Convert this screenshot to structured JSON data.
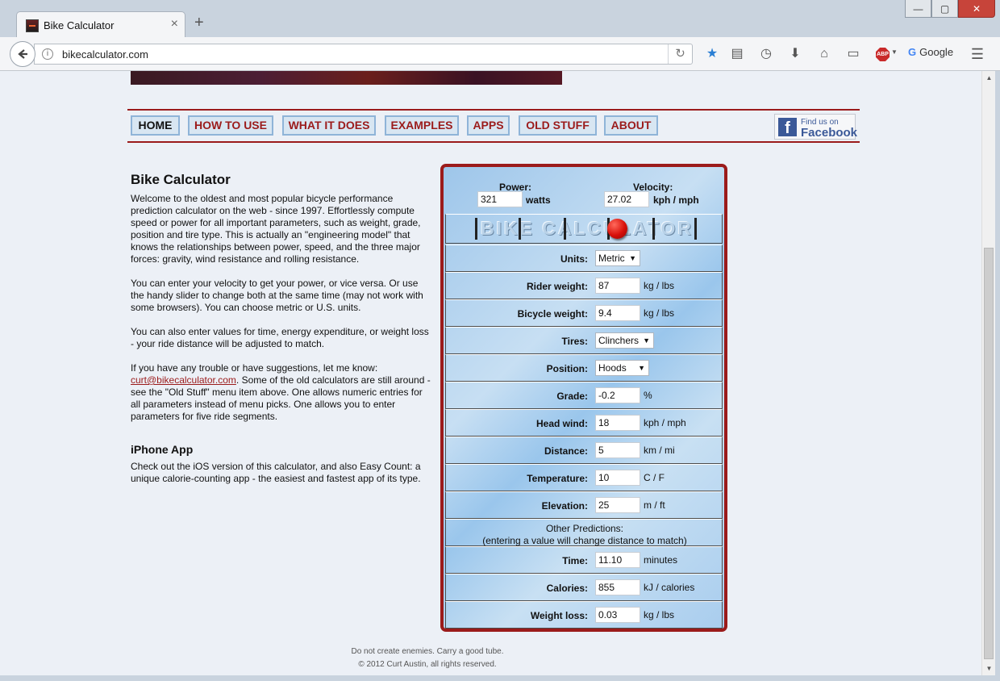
{
  "browser": {
    "tab_title": "Bike Calculator",
    "tab_close": "×",
    "new_tab": "+",
    "url": "bikecalculator.com",
    "search_engine": "Google",
    "window_buttons": {
      "minimize": "—",
      "maximize": "▢",
      "close": "✕"
    }
  },
  "menu": {
    "items": [
      "HOME",
      "HOW TO USE",
      "WHAT IT DOES",
      "EXAMPLES",
      "APPS",
      "OLD STUFF",
      "ABOUT"
    ],
    "facebook_small": "Find us on",
    "facebook_big": "Facebook"
  },
  "intro": {
    "title": "Bike Calculator",
    "p1": "Welcome to the oldest and most popular bicycle performance prediction calculator on the web - since 1997. Effortlessly compute speed or power for all important parameters, such as weight, grade, position and tire type. This is actually an \"engineering model\" that knows the relationships between power, speed, and the three major forces: gravity, wind resistance and rolling resistance.",
    "p2": "You can enter your velocity to get your power, or vice versa. Or use the handy slider to change both at the same time (may not work with some browsers). You can choose metric or U.S. units.",
    "p3": "You can also enter values for time, energy expenditure, or weight loss - your ride distance will be adjusted to match.",
    "p4_before": "If you have any trouble or have suggestions, let me know:",
    "email": "curt@bikecalculator.com",
    "p4_after": ". Some of the old calculators are still around - see the \"Old Stuff\" menu item above. One allows numeric entries for all parameters instead of menu picks. One allows you to enter parameters for five ride segments.",
    "iphone_title": "iPhone App",
    "iphone_text": "Check out the iOS version of this calculator, and also Easy Count: a unique calorie-counting app - the easiest and fastest app of its type."
  },
  "calc": {
    "power_label": "Power:",
    "power_value": "321",
    "power_unit": "watts",
    "velocity_label": "Velocity:",
    "velocity_value": "27.02",
    "velocity_unit": "kph / mph",
    "slider_text": "BIKE CALCULATOR",
    "units_label": "Units:",
    "units_value": "Metric",
    "rider_weight_label": "Rider weight:",
    "rider_weight_value": "87",
    "rider_weight_unit": "kg / lbs",
    "bicycle_weight_label": "Bicycle weight:",
    "bicycle_weight_value": "9.4",
    "bicycle_weight_unit": "kg / lbs",
    "tires_label": "Tires:",
    "tires_value": "Clinchers",
    "position_label": "Position:",
    "position_value": "Hoods",
    "grade_label": "Grade:",
    "grade_value": "-0.2",
    "grade_unit": "%",
    "headwind_label": "Head wind:",
    "headwind_value": "18",
    "headwind_unit": "kph / mph",
    "distance_label": "Distance:",
    "distance_value": "5",
    "distance_unit": "km / mi",
    "temperature_label": "Temperature:",
    "temperature_value": "10",
    "temperature_unit": "C / F",
    "elevation_label": "Elevation:",
    "elevation_value": "25",
    "elevation_unit": "m / ft",
    "other_line1": "Other Predictions:",
    "other_line2": "(entering a value will change distance to match)",
    "time_label": "Time:",
    "time_value": "11.10",
    "time_unit": "minutes",
    "calories_label": "Calories:",
    "calories_value": "855",
    "calories_unit": "kJ / calories",
    "weight_loss_label": "Weight loss:",
    "weight_loss_value": "0.03",
    "weight_loss_unit": "kg / lbs"
  },
  "footer": {
    "line1": "Do not create enemies. Carry a good tube.",
    "line2": "© 2012 Curt Austin, all rights reserved."
  }
}
